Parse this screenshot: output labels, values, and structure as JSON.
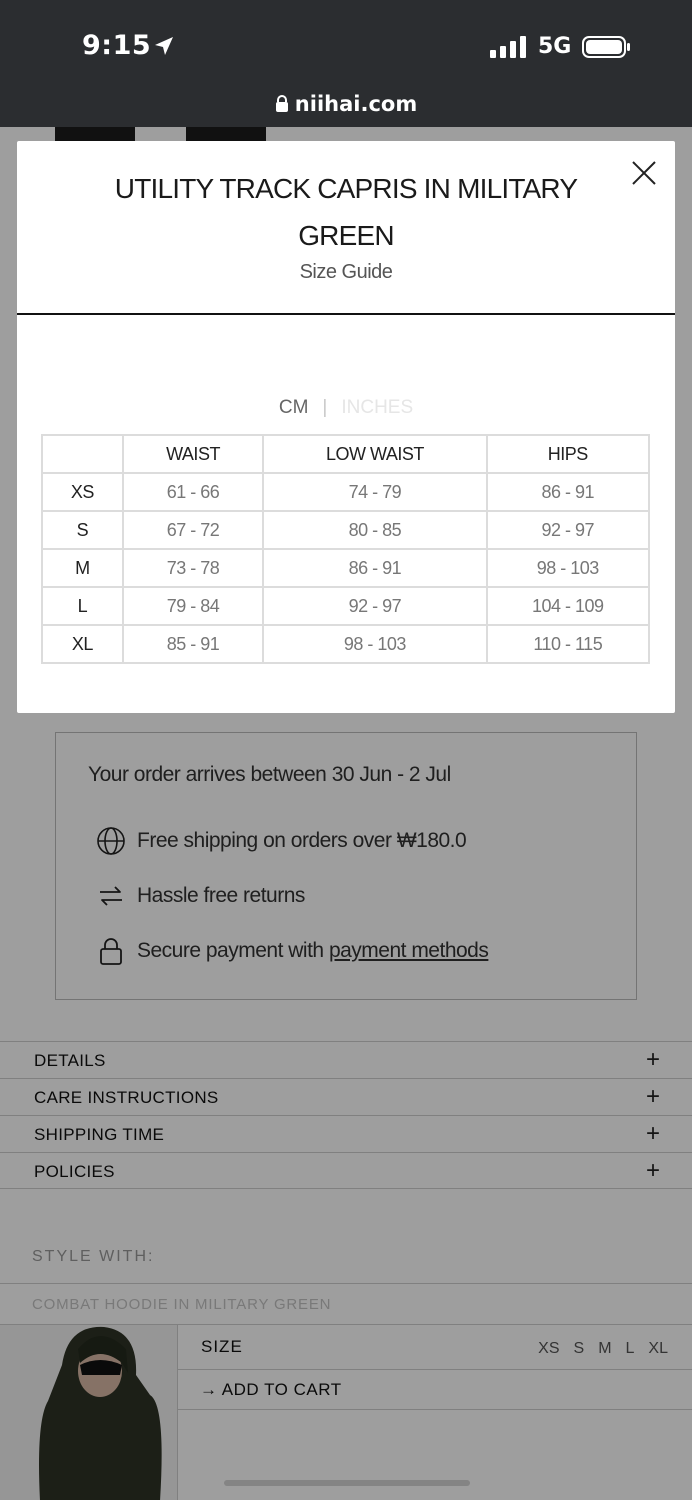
{
  "status_bar": {
    "time": "9:15",
    "network": "5G",
    "url": "niihai.com"
  },
  "modal": {
    "title": "UTILITY TRACK CAPRIS IN MILITARY GREEN",
    "subtitle": "Size Guide",
    "units": {
      "active": "CM",
      "separator": "|",
      "inactive": "INCHES"
    },
    "table": {
      "headers": [
        "",
        "WAIST",
        "LOW WAIST",
        "HIPS"
      ],
      "rows": [
        [
          "XS",
          "61 - 66",
          "74 - 79",
          "86 - 91"
        ],
        [
          "S",
          "67 - 72",
          "80 - 85",
          "92 - 97"
        ],
        [
          "M",
          "73 - 78",
          "86 - 91",
          "98 - 103"
        ],
        [
          "L",
          "79 - 84",
          "92 - 97",
          "104 - 109"
        ],
        [
          "XL",
          "85 - 91",
          "98 - 103",
          "110 - 115"
        ]
      ]
    }
  },
  "page": {
    "arrival": "Your order arrives between 30 Jun - 2 Jul",
    "perks": {
      "shipping": "Free shipping on orders over ₩180.0",
      "returns": "Hassle free returns",
      "payment_prefix": "Secure payment with ",
      "payment_link": "payment methods"
    },
    "accordion": [
      "DETAILS",
      "CARE INSTRUCTIONS",
      "SHIPPING TIME",
      "POLICIES"
    ],
    "accordion_icon": "+",
    "style_with": "STYLE WITH:",
    "related_product": "COMBAT HOODIE IN MILITARY GREEN",
    "size_label": "SIZE",
    "size_options": [
      "XS",
      "S",
      "M",
      "L",
      "XL"
    ],
    "add_to_cart": "→ ADD TO CART"
  },
  "colors": {
    "status_bar_bg": "#2b2d30",
    "overlay": "rgba(0,0,0,0.38)",
    "modal_bg": "#ffffff"
  }
}
